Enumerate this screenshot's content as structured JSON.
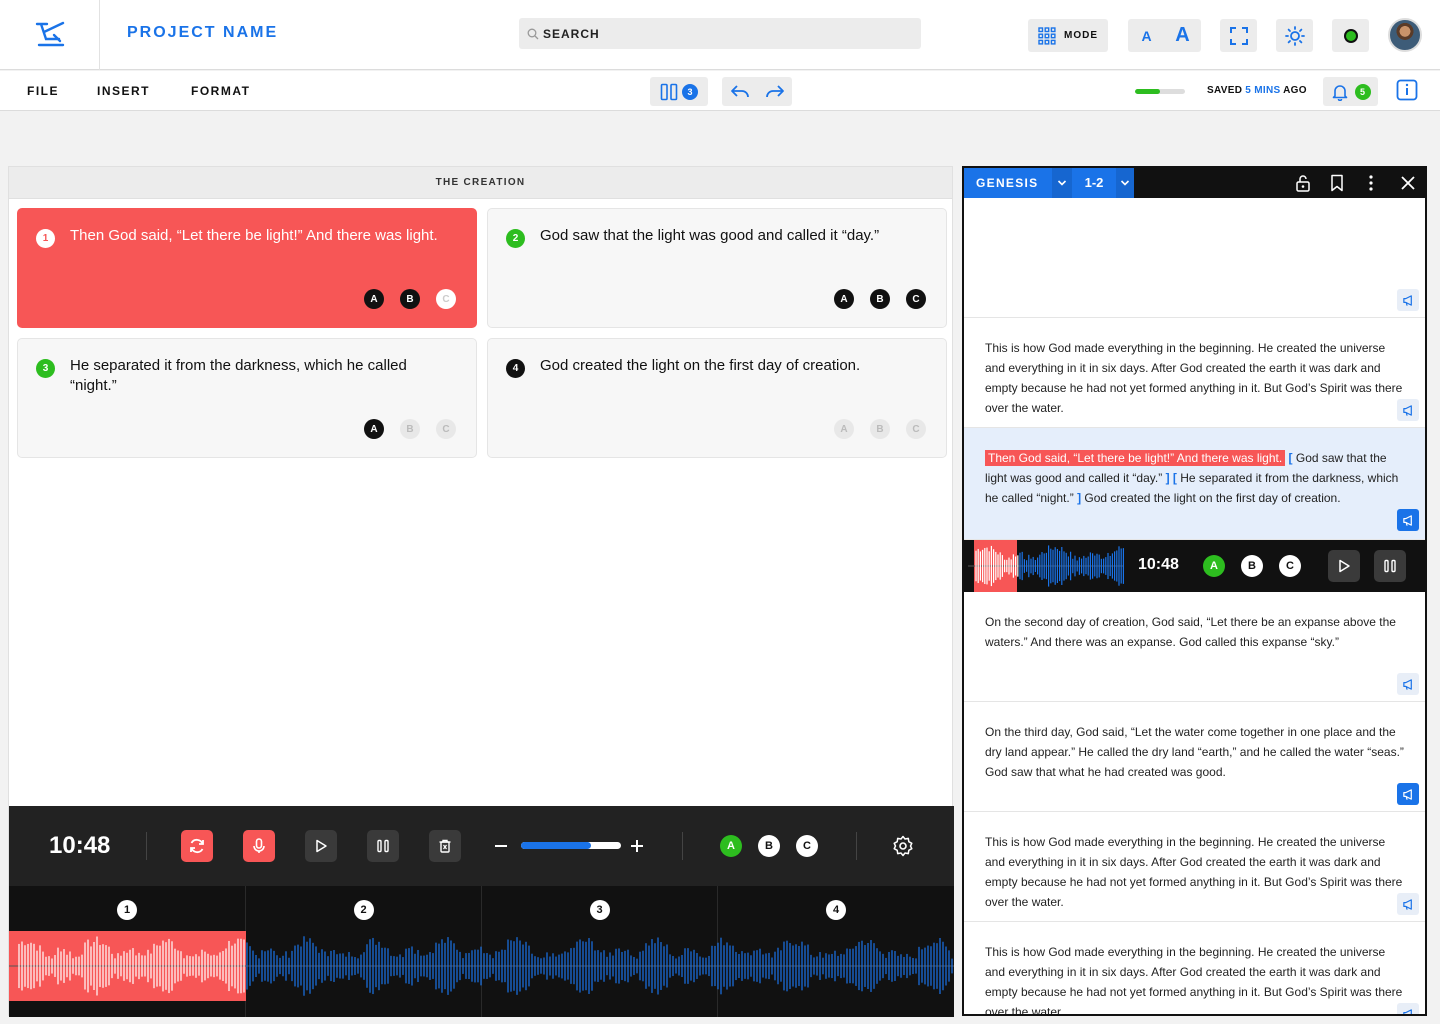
{
  "header": {
    "project_name": "PROJECT NAME",
    "search_label": "SEARCH",
    "mode_label": "MODE",
    "font_small": "A",
    "font_large": "A"
  },
  "menu": {
    "file": "FILE",
    "insert": "INSERT",
    "format": "FORMAT",
    "columns_count": "3",
    "save_progress": 0.5,
    "saved_prefix": "SAVED ",
    "saved_time": "5 MINS",
    "saved_suffix": " AGO",
    "notifications_count": "5"
  },
  "left_panel": {
    "title": "THE CREATION",
    "cards": [
      {
        "number": "1",
        "text": "Then God said, “Let there be light!” And there was light.",
        "state": "active",
        "chips": [
          "A",
          "B",
          "C"
        ]
      },
      {
        "number": "2",
        "text": "God saw that the light was good and called it “day.”",
        "state": "normal",
        "chips": [
          "A",
          "B",
          "C"
        ]
      },
      {
        "number": "3",
        "text": "He separated it from the darkness, which he called “night.”",
        "state": "normal",
        "chips": [
          "A",
          "B",
          "C"
        ]
      },
      {
        "number": "4",
        "text": "God created the light on the first day of creation.",
        "state": "normal",
        "chips": [
          "A",
          "B",
          "C"
        ]
      }
    ]
  },
  "player": {
    "time": "10:48",
    "volume": 0.7,
    "chips": [
      "A",
      "B",
      "C"
    ]
  },
  "timeline": {
    "segments": [
      "1",
      "2",
      "3",
      "4"
    ]
  },
  "right_panel": {
    "book": "GENESIS",
    "chapter": "1-2",
    "blocks": [
      {
        "text": ""
      },
      {
        "text": "This is how God made everything in the beginning. He created the universe and everything in it in six days. After God created the earth it was dark and empty because he had not yet formed anything in it. But God’s Spirit was there over the water."
      },
      {
        "highlight": "Then God said, “Let there be light!” And there was light.",
        "rest1": "God saw that the light was good and called it “day.”",
        "rest2": "He separated it from the darkness, which he called “night.”",
        "rest3": "God created the light on the first day of creation."
      },
      {
        "text": "On the second day of creation, God said, “Let there be an expanse above the waters.” And there was an expanse. God called this expanse “sky.”"
      },
      {
        "text": "On the third day, God said, “Let the water come together in one place and the dry land appear.” He called the dry land “earth,” and he called the water “seas.” God saw that what he had created was good."
      },
      {
        "text": "This is how God made everything in the beginning. He created the universe and everything in it in six days. After God created the earth it was dark and empty because he had not yet formed anything in it. But God’s Spirit was there over the water."
      },
      {
        "text": "This is how God made everything in the beginning. He created the universe and everything in it in six days. After God created the earth it was dark and empty because he had not yet formed anything in it. But God’s Spirit was there over the water."
      }
    ],
    "player_time": "10:48",
    "player_chips": [
      "A",
      "B",
      "C"
    ]
  },
  "colors": {
    "accent": "#1a73e8",
    "active_red": "#f75656",
    "green": "#2dbd1f"
  }
}
